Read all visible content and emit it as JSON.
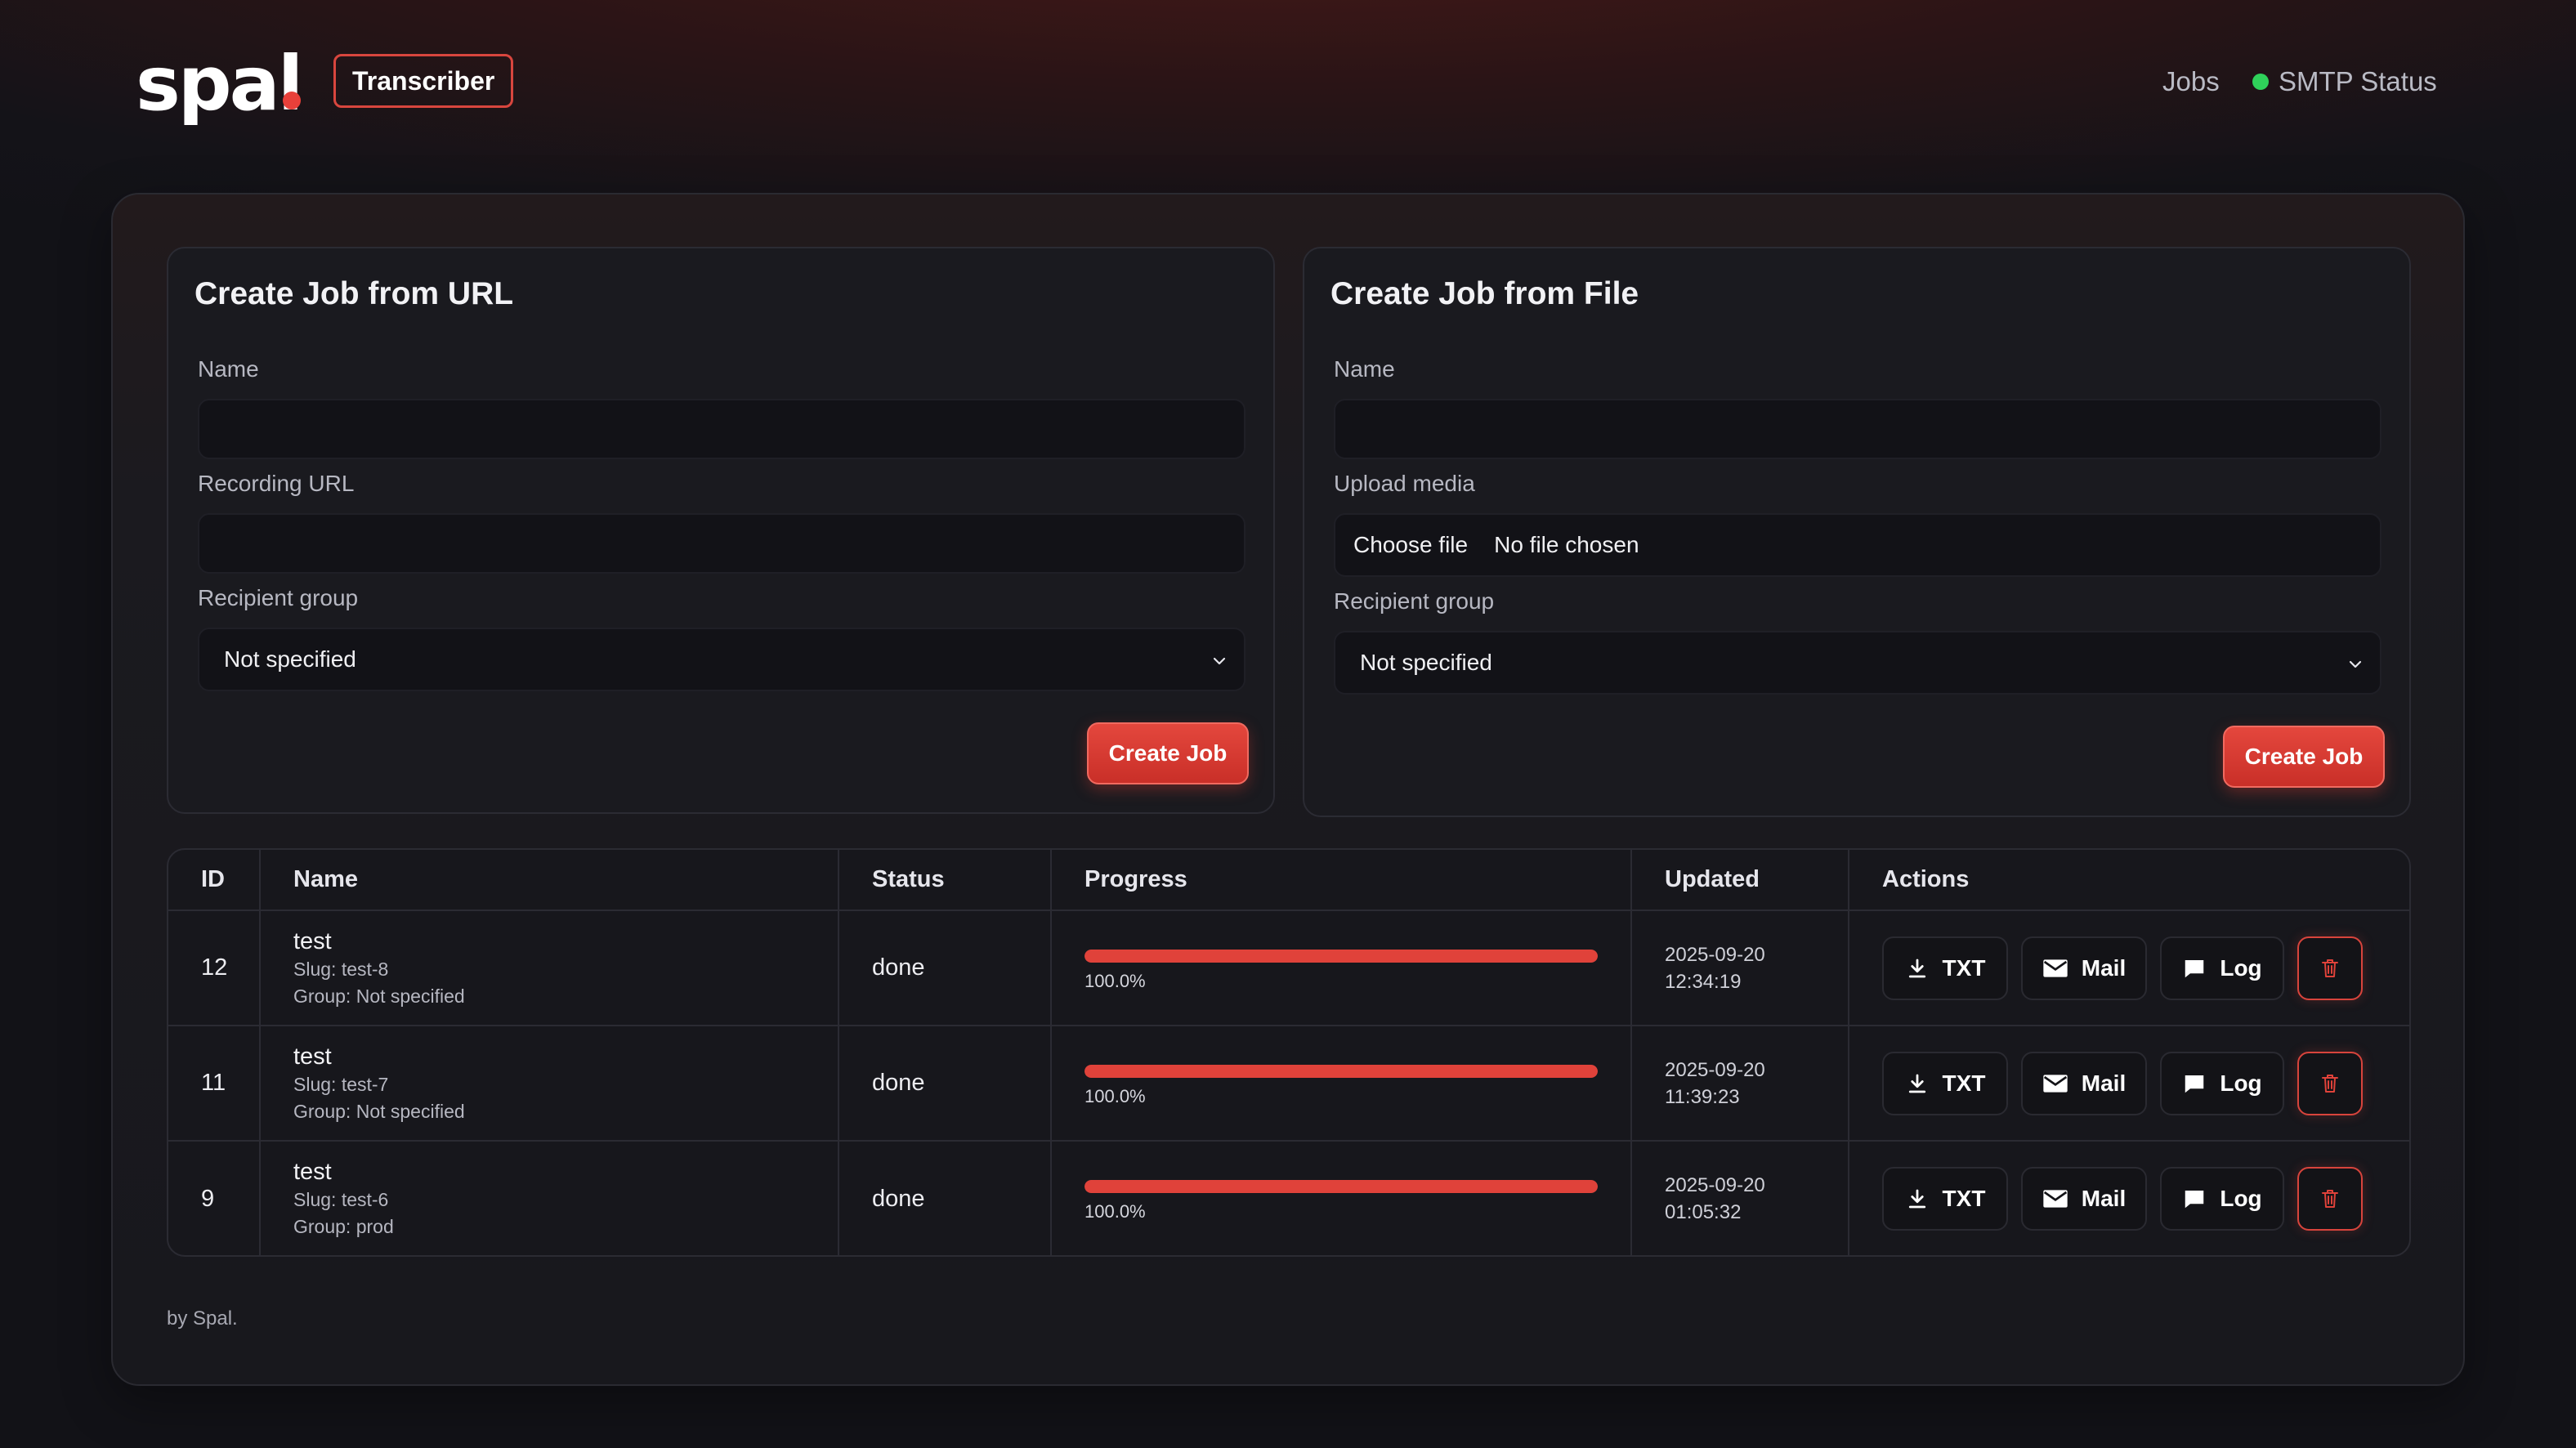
{
  "brand": {
    "logo_text": "spal",
    "badge": "Transcriber"
  },
  "nav": {
    "jobs": "Jobs",
    "smtp_status": "SMTP Status",
    "smtp_color": "#2fd15a"
  },
  "url_form": {
    "title": "Create Job from URL",
    "name_label": "Name",
    "name_value": "",
    "url_label": "Recording URL",
    "url_value": "",
    "group_label": "Recipient group",
    "group_value": "Not specified",
    "submit": "Create Job"
  },
  "file_form": {
    "title": "Create Job from File",
    "name_label": "Name",
    "name_value": "",
    "upload_label": "Upload media",
    "choose_file": "Choose file",
    "file_status": "No file chosen",
    "group_label": "Recipient group",
    "group_value": "Not specified",
    "submit": "Create Job"
  },
  "table": {
    "headers": [
      "ID",
      "Name",
      "Status",
      "Progress",
      "Updated",
      "Actions"
    ],
    "action_labels": {
      "txt": "TXT",
      "mail": "Mail",
      "log": "Log"
    },
    "rows": [
      {
        "id": "12",
        "name": "test",
        "slug": "Slug: test-8",
        "group": "Group: Not specified",
        "status": "done",
        "progress": 1.0,
        "progress_text": "100.0%",
        "updated_date": "2025-09-20",
        "updated_time": "12:34:19"
      },
      {
        "id": "11",
        "name": "test",
        "slug": "Slug: test-7",
        "group": "Group: Not specified",
        "status": "done",
        "progress": 1.0,
        "progress_text": "100.0%",
        "updated_date": "2025-09-20",
        "updated_time": "11:39:23"
      },
      {
        "id": "9",
        "name": "test",
        "slug": "Slug: test-6",
        "group": "Group: prod",
        "status": "done",
        "progress": 1.0,
        "progress_text": "100.0%",
        "updated_date": "2025-09-20",
        "updated_time": "01:05:32"
      }
    ]
  },
  "footer": "by Spal.",
  "colors": {
    "accent": "#e0423a",
    "background": "#121217"
  }
}
